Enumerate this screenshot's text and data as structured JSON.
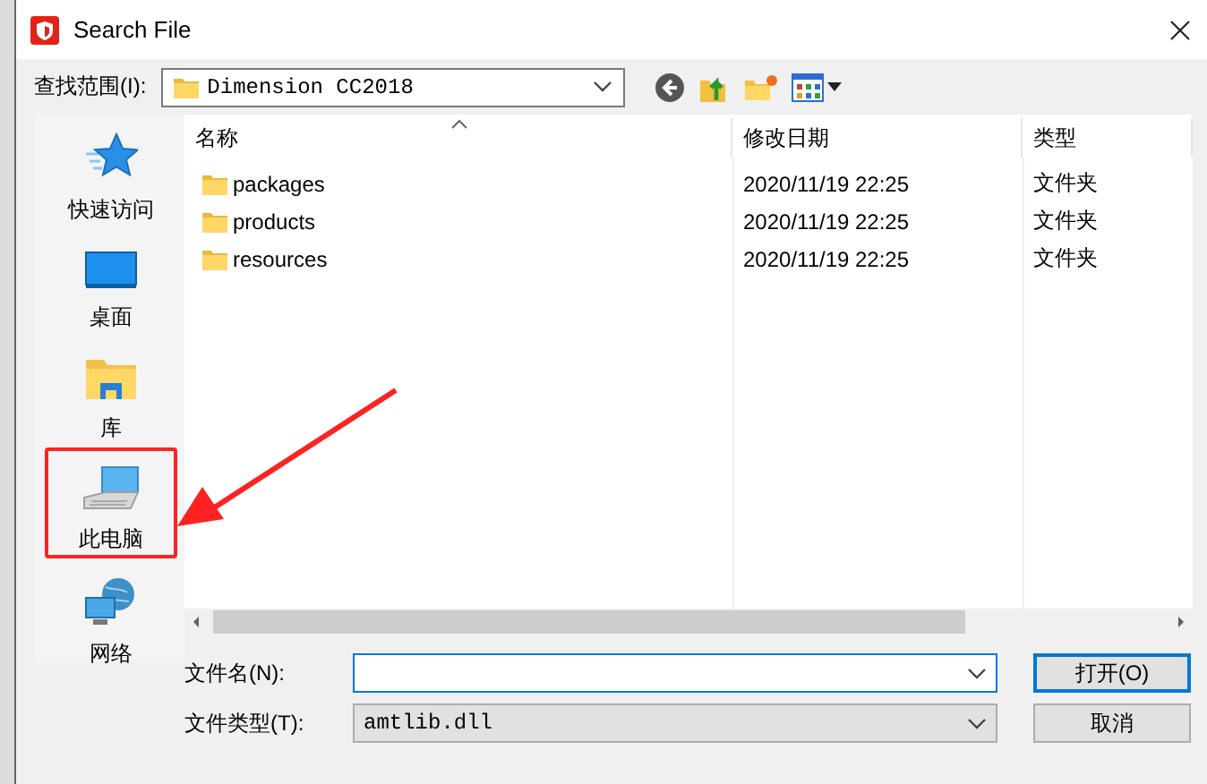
{
  "window": {
    "title": "Search File"
  },
  "look_in": {
    "label": "查找范围(I):",
    "value": "Dimension CC2018"
  },
  "sidebar": {
    "items": [
      {
        "label": "快速访问",
        "kind": "star",
        "highlighted": false
      },
      {
        "label": "桌面",
        "kind": "desktop",
        "highlighted": false
      },
      {
        "label": "库",
        "kind": "library",
        "highlighted": false
      },
      {
        "label": "此电脑",
        "kind": "computer",
        "highlighted": true
      },
      {
        "label": "网络",
        "kind": "network",
        "highlighted": false
      }
    ]
  },
  "columns": [
    {
      "label": "名称",
      "sorted": true
    },
    {
      "label": "修改日期",
      "sorted": false
    },
    {
      "label": "类型",
      "sorted": false
    }
  ],
  "files": [
    {
      "name": "packages",
      "modified": "2020/11/19 22:25",
      "type": "文件夹"
    },
    {
      "name": "products",
      "modified": "2020/11/19 22:25",
      "type": "文件夹"
    },
    {
      "name": "resources",
      "modified": "2020/11/19 22:25",
      "type": "文件夹"
    }
  ],
  "file_name": {
    "label": "文件名(N):",
    "focused": true
  },
  "file_type": {
    "label": "文件类型(T):",
    "value": "amtlib.dll"
  },
  "buttons": [
    {
      "label": "打开(O)",
      "default": true
    },
    {
      "label": "取消",
      "default": false
    }
  ]
}
